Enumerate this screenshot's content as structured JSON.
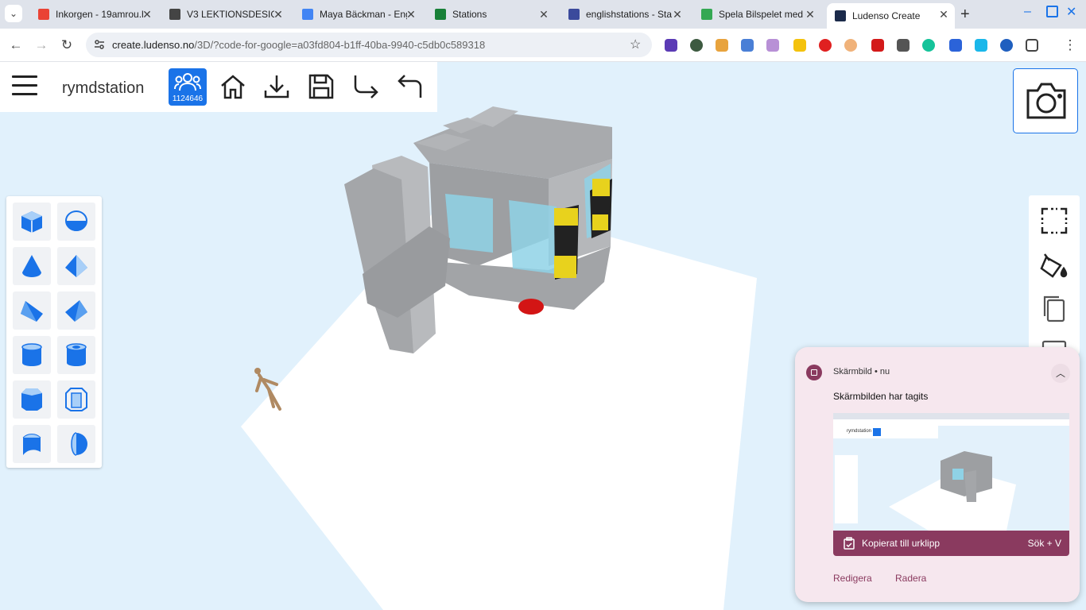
{
  "browser": {
    "tabs": [
      {
        "title": "Inkorgen - 19amrou.h",
        "fav_color": "#ea4335"
      },
      {
        "title": "V3 LEKTIONSDESIGN",
        "fav_color": "#444444"
      },
      {
        "title": "Maya Bäckman - Eng",
        "fav_color": "#4285f4"
      },
      {
        "title": "Stations",
        "fav_color": "#188038"
      },
      {
        "title": "englishstations - Sta",
        "fav_color": "#3b4a9c"
      },
      {
        "title": "Spela Bilspelet med d",
        "fav_color": "#34a853"
      },
      {
        "title": "Ludenso Create",
        "fav_color": "#1b2a4a"
      }
    ],
    "url_host": "create.ludenso.no",
    "url_path": "/3D/?code-for-google=a03fd804-b1ff-40ba-9940-c5db0c589318"
  },
  "toolbar": {
    "project_name": "rymdstation",
    "community_count": "1124646"
  },
  "notification": {
    "app_name": "Skärmbild • nu",
    "title": "Skärmbilden har tagits",
    "copied_label": "Kopierat till urklipp",
    "shortcut": "Sök + V",
    "edit_label": "Redigera",
    "delete_label": "Radera",
    "thumb_project_name": "rymdstation"
  },
  "colors": {
    "accent": "#1a73e8",
    "notif_accent": "#8a3a5f",
    "canvas_bg": "#e1f1fc"
  }
}
